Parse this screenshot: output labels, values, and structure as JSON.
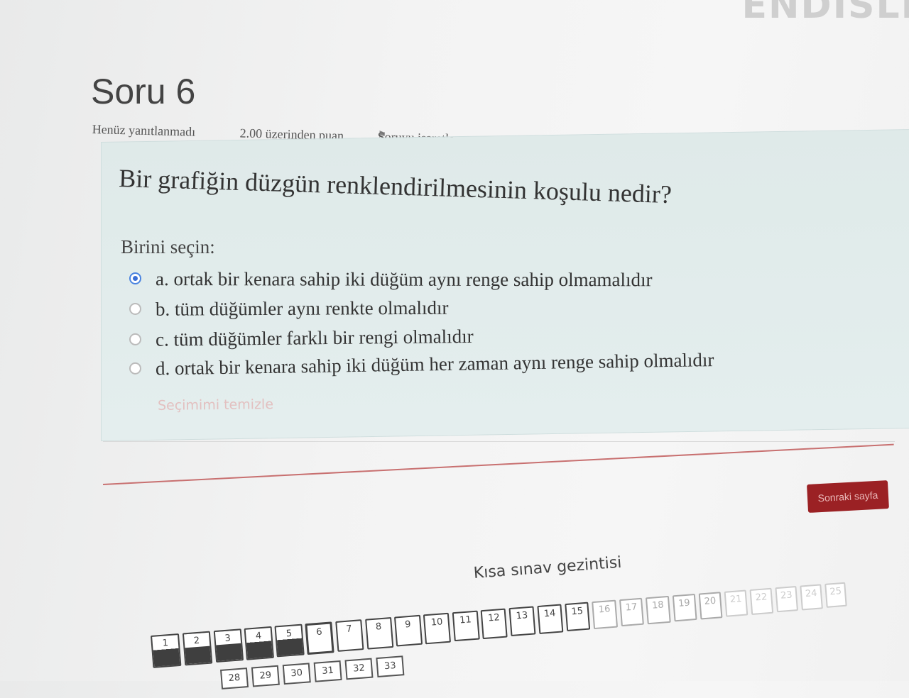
{
  "header": {
    "brand_fragment": "ENDİSLİ"
  },
  "question": {
    "number_label": "Soru 6",
    "status": "Henüz yanıtlanmadı",
    "grade": "2.00 üzerinden puan",
    "flag_label": "Soruyu işaretle",
    "text": "Bir grafiğin düzgün renklendirilmesinin koşulu nedir?",
    "prompt": "Birini seçin:",
    "options": [
      {
        "label": "a. ortak bir kenara sahip iki düğüm aynı renge sahip olmamalıdır",
        "selected": true
      },
      {
        "label": "b. tüm düğümler aynı renkte olmalıdır",
        "selected": false
      },
      {
        "label": "c. tüm düğümler farklı bir rengi olmalıdır",
        "selected": false
      },
      {
        "label": "d. ortak bir kenara sahip iki düğüm her zaman aynı renge sahip olmalıdır",
        "selected": false
      }
    ],
    "clear_label": "Seçimimi temizle"
  },
  "navigation": {
    "next_label": "Sonraki sayfa",
    "title": "Kısa sınav gezintisi",
    "buttons_row1": [
      "1",
      "2",
      "3",
      "4",
      "5",
      "6",
      "7",
      "8",
      "9",
      "10",
      "11",
      "12",
      "13",
      "14",
      "15",
      "16",
      "17",
      "18",
      "19",
      "20",
      "21",
      "22",
      "23",
      "24",
      "25"
    ],
    "buttons_row2": [
      "28",
      "29",
      "30",
      "31",
      "32",
      "33"
    ],
    "current": "6",
    "answered": [
      "1",
      "2",
      "3",
      "4",
      "5"
    ]
  },
  "colors": {
    "accent": "#9b2124",
    "question_bg": "#e2ecec",
    "radio_selected": "#3b6fd6"
  }
}
